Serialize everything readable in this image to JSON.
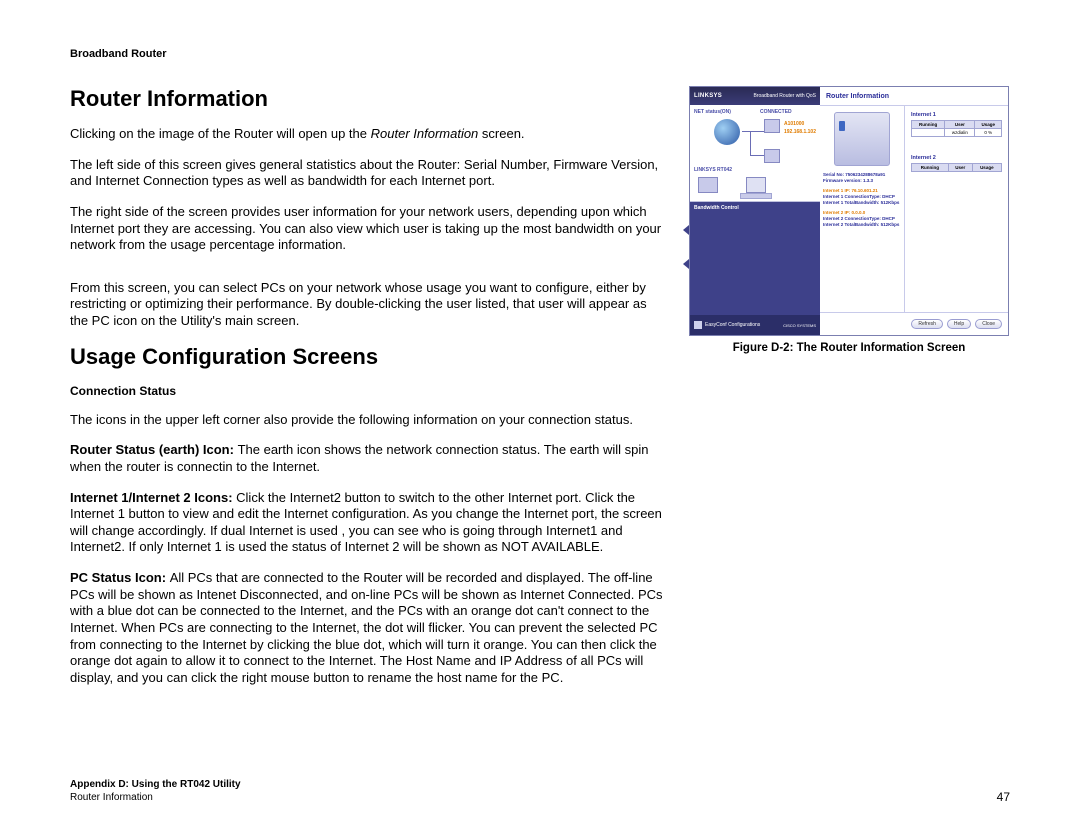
{
  "header": "Broadband Router",
  "section1": {
    "title": "Router Information",
    "p1a": "Clicking on the image of the Router will open up the ",
    "p1i": "Router Information",
    "p1b": " screen.",
    "p2": "The left side of this screen gives general statistics about the Router: Serial Number, Firmware Version, and Internet Connection types as well as bandwidth for each Internet port.",
    "p3": "The right side of the screen provides user information for your network users, depending upon which Internet port they are accessing. You can also view which user is taking up the most bandwidth on your network from the usage percentage information.",
    "p4": "From this screen, you can select PCs on your network whose usage you want to configure, either by restricting or optimizing their performance. By double-clicking the user listed, that user will appear as the PC icon on the Utility's main screen."
  },
  "section2": {
    "title": "Usage Configuration Screens",
    "sub1": "Connection Status",
    "p1": "The icons in the upper left corner also provide the following information on your connection status.",
    "p2a": "Router Status (earth) Icon: ",
    "p2b": "The earth icon shows the network connection status. The earth will spin when the router is connectin to the Internet.",
    "p3a": "Internet 1/Internet 2 Icons: ",
    "p3b": "Click the Internet2 button to switch to the other Internet port. Click the Internet 1 button to view and edit the Internet configuration. As you change the Internet port, the screen will change accordingly. If dual Internet is used , you can see who is going through Internet1 and Internet2. If only Internet 1 is used the status of Internet 2 will be shown as NOT AVAILABLE.",
    "p4a": "PC Status Icon: ",
    "p4b": "All PCs that are connected to the Router will be recorded and displayed. The off-line PCs will be shown as Intenet Disconnected, and on-line PCs will be shown as Internet Connected. PCs with a blue dot can be connected to the Internet, and the PCs with an orange dot can't connect to the Internet. When PCs are connecting to the Internet, the dot will flicker. You can prevent the selected PC from connecting to the Internet by clicking the blue dot, which will turn it orange. You can then click the orange dot again to allow it to connect to the Internet. The Host Name and IP Address of all PCs will display, and you can click the right mouse button to rename the host name for the PC."
  },
  "figure": {
    "caption": "Figure D-2: The Router Information Screen",
    "logo": "LINKSYS",
    "product": "Broadband Router with QoS",
    "net_status": "NET status(ON)",
    "connected": "CONNECTED",
    "model": "LINKSYS RT042",
    "ip1": "A101000",
    "ip2": "192.168.1.102",
    "bandwidth_label": "Bandwidth Control",
    "easyconf": "EasyConf Configurations",
    "panel_title": "Router Information",
    "info_lines": [
      "Serial No: 7506234288678a91",
      "Firmware version: 1.3.3",
      "",
      "Internet 1 IP: 76.10.601.21",
      "Internet 1 ConnectionType: DHCP",
      "Internet 1 TotalBandwidth: 512Kbps",
      "",
      "Internet 2 IP: 0.0.0.0",
      "Internet 2 ConnectionType: DHCP",
      "Internet 2 TotalBandwidth: 512Kbps"
    ],
    "table1": {
      "name": "Internet 1",
      "headers": [
        "Running",
        "User",
        "Usage"
      ],
      "row": [
        "",
        "wzdialin",
        "0 %"
      ]
    },
    "table2": {
      "name": "Internet 2",
      "headers": [
        "Running",
        "User",
        "Usage"
      ]
    },
    "buttons": [
      "Refresh",
      "Help",
      "Close"
    ]
  },
  "footer": {
    "line1": "Appendix D: Using the RT042 Utility",
    "line2": "Router Information",
    "page": "47"
  }
}
